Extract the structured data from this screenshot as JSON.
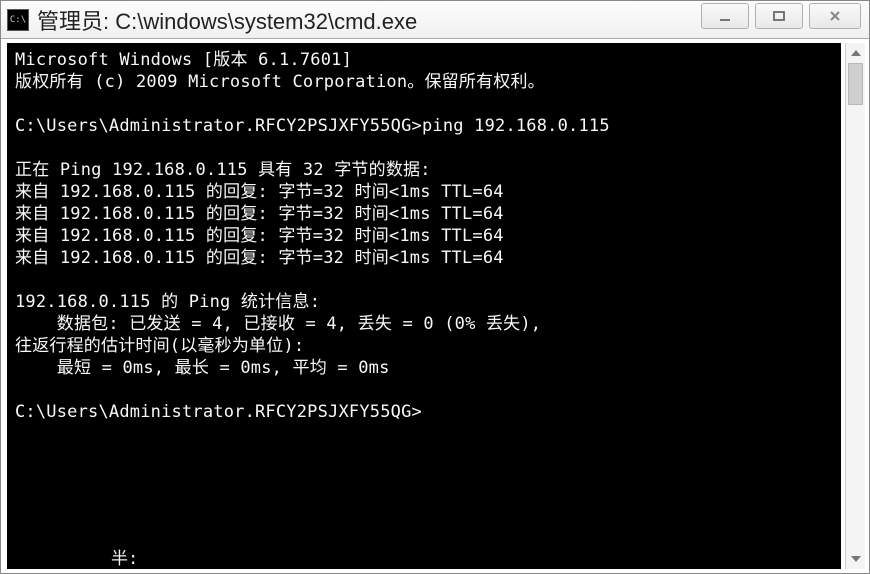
{
  "window": {
    "app_icon_text": "C:\\",
    "title": "管理员: C:\\windows\\system32\\cmd.exe"
  },
  "terminal": {
    "lines": [
      "Microsoft Windows [版本 6.1.7601]",
      "版权所有 (c) 2009 Microsoft Corporation。保留所有权利。",
      "",
      "C:\\Users\\Administrator.RFCY2PSJXFY55QG>ping 192.168.0.115",
      "",
      "正在 Ping 192.168.0.115 具有 32 字节的数据:",
      "来自 192.168.0.115 的回复: 字节=32 时间<1ms TTL=64",
      "来自 192.168.0.115 的回复: 字节=32 时间<1ms TTL=64",
      "来自 192.168.0.115 的回复: 字节=32 时间<1ms TTL=64",
      "来自 192.168.0.115 的回复: 字节=32 时间<1ms TTL=64",
      "",
      "192.168.0.115 的 Ping 统计信息:",
      "    数据包: 已发送 = 4, 已接收 = 4, 丢失 = 0 (0% 丢失),",
      "往返行程的估计时间(以毫秒为单位):",
      "    最短 = 0ms, 最长 = 0ms, 平均 = 0ms",
      "",
      "C:\\Users\\Administrator.RFCY2PSJXFY55QG>"
    ],
    "stray_text": "半:"
  }
}
